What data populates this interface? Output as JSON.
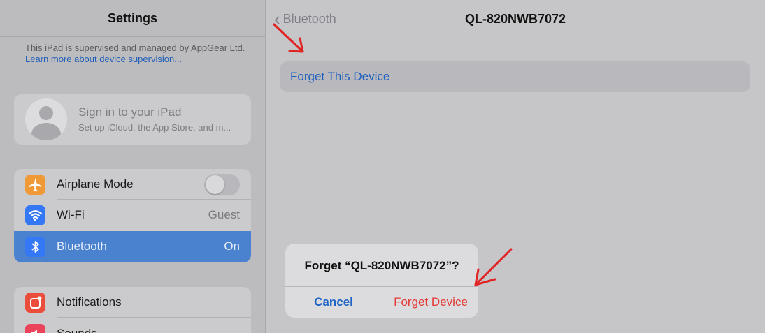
{
  "sidebar": {
    "title": "Settings",
    "supervision_text": "This iPad is supervised and managed by AppGear Ltd.",
    "supervision_link": "Learn more about device supervision...",
    "signin": {
      "title": "Sign in to your iPad",
      "subtitle": "Set up iCloud, the App Store, and m..."
    },
    "items": [
      {
        "label": "Airplane Mode",
        "icon": "airplane-icon",
        "color": "#f09a37",
        "toggle": false
      },
      {
        "label": "Wi-Fi",
        "value": "Guest",
        "icon": "wifi-icon",
        "color": "#3478f6"
      },
      {
        "label": "Bluetooth",
        "value": "On",
        "icon": "bluetooth-icon",
        "color": "#3478f6",
        "selected": true
      },
      {
        "label": "Notifications",
        "icon": "notifications-icon",
        "color": "#eb4d3d"
      },
      {
        "label": "Sounds",
        "icon": "sounds-icon",
        "color": "#eb445a"
      }
    ]
  },
  "detail": {
    "back_label": "Bluetooth",
    "title": "QL-820NWB7072",
    "forget_label": "Forget This Device"
  },
  "alert": {
    "title": "Forget “QL-820NWB7072”?",
    "cancel": "Cancel",
    "confirm": "Forget Device"
  },
  "colors": {
    "accent": "#1d5fbe",
    "selected_row": "#4a82cf",
    "destructive": "#e53935",
    "annotation_arrow": "#e02424"
  }
}
